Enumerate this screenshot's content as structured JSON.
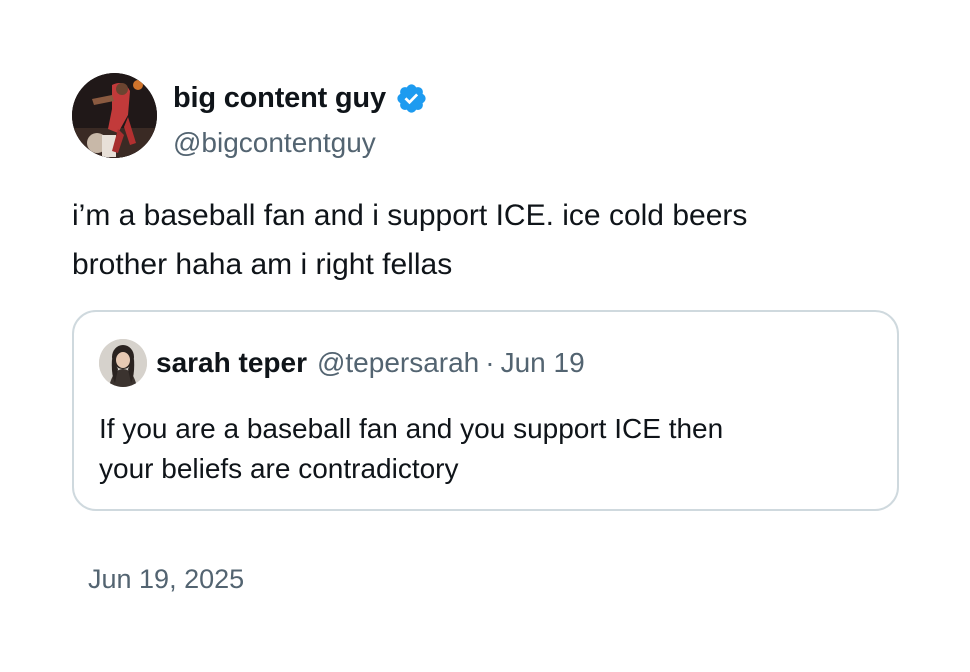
{
  "author": {
    "display_name": "big content guy",
    "handle": "@bigcontentguy",
    "verified_icon": "verified-badge-icon",
    "verified_color": "#1d9bf0"
  },
  "tweet": {
    "text": "i’m a baseball fan and i support ICE. ice cold beers\nbrother haha am i right fellas",
    "timestamp": "Jun 19, 2025"
  },
  "quoted_tweet": {
    "display_name": "sarah teper",
    "handle": "@tepersarah",
    "separator": "·",
    "date": "Jun 19",
    "text": "If you are a baseball fan and you support ICE then\nyour beliefs are contradictory"
  },
  "colors": {
    "primary_text": "#0f1419",
    "secondary_text": "#536471",
    "border": "#cfd9de",
    "accent": "#1d9bf0"
  }
}
